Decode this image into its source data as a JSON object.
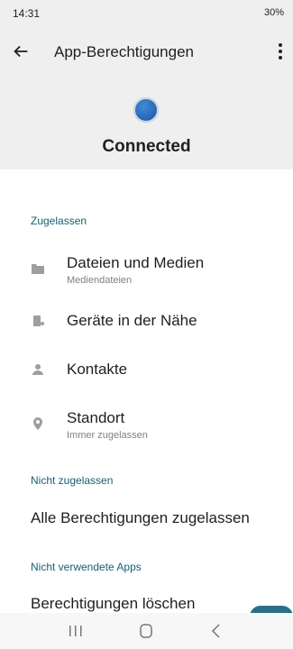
{
  "status": {
    "time": "14:31",
    "right": "30%"
  },
  "appbar": {
    "title": "App-Berechtigungen"
  },
  "app": {
    "name": "Connected"
  },
  "sections": {
    "allowed": "Zugelassen",
    "not_allowed": "Nicht zugelassen",
    "unused": "Nicht verwendete Apps"
  },
  "permissions": [
    {
      "title": "Dateien und Medien",
      "subtitle": "Mediendateien",
      "icon": "folder-icon"
    },
    {
      "title": "Geräte in der Nähe",
      "subtitle": "",
      "icon": "nearby-devices-icon"
    },
    {
      "title": "Kontakte",
      "subtitle": "",
      "icon": "contacts-icon"
    },
    {
      "title": "Standort",
      "subtitle": "Immer zugelassen",
      "icon": "location-icon"
    }
  ],
  "not_allowed_item": "Alle Berechtigungen zugelassen",
  "unused_item": "Berechtigungen löschen",
  "colors": {
    "accent": "#166072",
    "top_bg": "#efefef"
  }
}
